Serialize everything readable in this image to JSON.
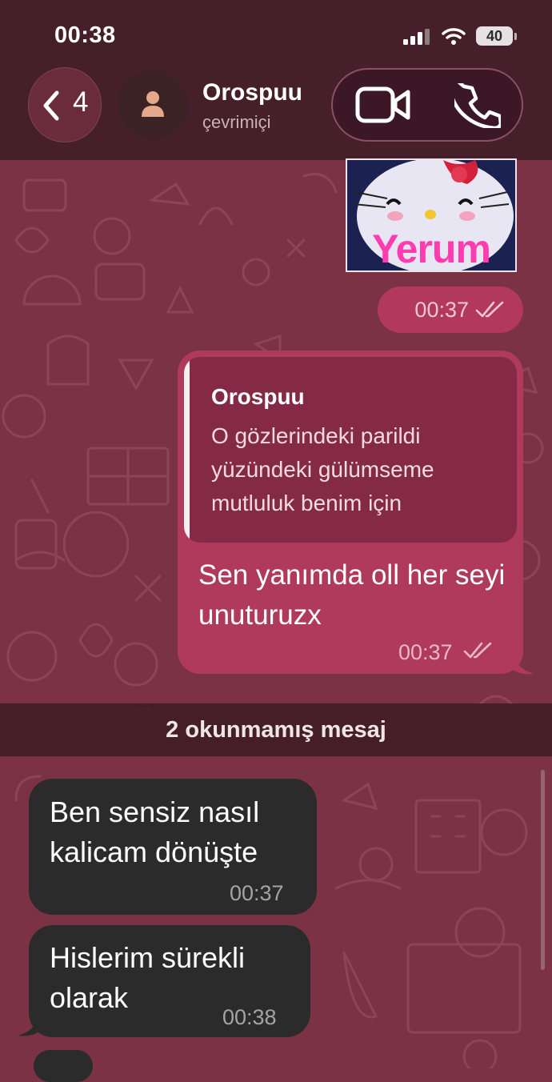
{
  "status_bar": {
    "time": "00:38",
    "battery": "40"
  },
  "header": {
    "back_count": "4",
    "contact_name": "Orospuu",
    "contact_status": "çevrimiçi"
  },
  "messages": {
    "image_message": {
      "caption": "Yerum",
      "time": "00:37"
    },
    "outgoing_reply": {
      "quoted_name": "Orospuu",
      "quoted_text": "O gözlerindeki parildi yüzündeki gülümseme mutluluk benim için",
      "text": "Sen yanımda oll her seyi unuturuzx",
      "time": "00:37"
    },
    "unread_divider": "2 okunmamış mesaj",
    "incoming": [
      {
        "text": "Ben sensiz nasıl kalicam dönüşte",
        "time": "00:37"
      },
      {
        "text": "Hislerim sürekli olarak",
        "time": "00:38"
      }
    ]
  },
  "colors": {
    "wallpaper": "#7a3244",
    "outgoing_bubble": "#b03a5c",
    "incoming_bubble": "#2b2b2b"
  }
}
